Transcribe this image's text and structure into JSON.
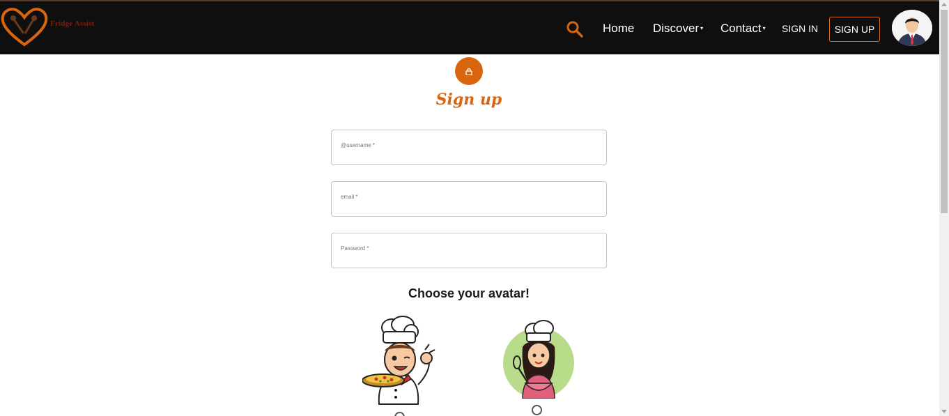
{
  "brand": {
    "name": "Fridge Assist"
  },
  "nav": {
    "home": "Home",
    "discover": "Discover",
    "contact": "Contact",
    "caret": "▾",
    "sign_in": "SIGN IN",
    "sign_up": "SIGN UP"
  },
  "form": {
    "title": "Sign up",
    "username_placeholder": "@username *",
    "email_placeholder": "email *",
    "password_placeholder": "Password *",
    "avatar_heading": "Choose your avatar!"
  },
  "colors": {
    "accent": "#d9660f",
    "navbar": "#0f0f0f",
    "brand_text": "#7a1f12"
  },
  "icons": {
    "search": "search-icon",
    "lock": "lock-icon",
    "user_avatar": "user-avatar-icon"
  }
}
